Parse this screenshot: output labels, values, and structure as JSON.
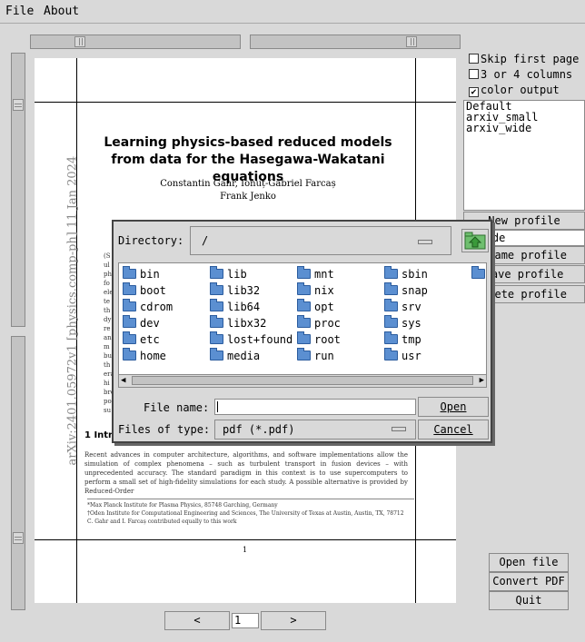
{
  "menu": {
    "file": "File",
    "about": "About"
  },
  "document": {
    "title": "Learning physics-based reduced models from data for the Hasegawa-Wakatani equations",
    "authors_line1": "Constantin Gahr, Ionuț-Gabriel Farcaș",
    "authors_line2": "Frank Jenko",
    "arxiv_stamp": "arXiv:2401.05972v1  [physics.comp-ph]  11 Jan 2024",
    "section_heading": "1  Intr",
    "intro_text": "Recent advances in computer architecture, algorithms, and software implementations allow the simulation of complex phenomena – such as turbulent transport in fusion devices – with unprecedented accuracy. The standard paradigm in this context is to use supercomputers to perform a small set of high-fidelity simulations for each study.  A possible alternative is provided by Reduced-Order",
    "footnote1": "*Max Planck Institute for Plasma Physics, 85748 Garching, Germany",
    "footnote2": "†Oden Institute for Computational Engineering and Sciences, The University of Texas at Austin, Austin, TX, 78712",
    "footnote3": "C. Gahr and I. Farcaș contributed equally to this work",
    "page_number": "1",
    "abstract_fragments": [
      "(S",
      "ul",
      "ph",
      "fo",
      "ele",
      "te",
      "th",
      "dy",
      "re",
      "an",
      "m",
      "bu",
      "th",
      "era",
      "hi",
      "bre",
      "po",
      "su"
    ]
  },
  "options": {
    "skip_first_page": {
      "label": "Skip first page",
      "checked": false
    },
    "columns": {
      "label": "3 or 4 columns",
      "checked": false
    },
    "color_output": {
      "label": "color output",
      "checked": true,
      "mark": "✔"
    }
  },
  "profiles": [
    "Default",
    "arxiv_small",
    "arxiv_wide"
  ],
  "profile_name_value": "v_wide",
  "profile_buttons": {
    "new": "New profile",
    "rename": "ename profile",
    "save": "Save profile",
    "delete": "elete profile"
  },
  "actions": {
    "open_file": "Open file",
    "convert_pdf": "Convert PDF",
    "quit": "Quit"
  },
  "pager": {
    "prev": "<",
    "next": ">",
    "page_value": "1"
  },
  "dialog": {
    "directory_label": "Directory:",
    "directory_value": "/",
    "files": [
      [
        "bin",
        "lib",
        "mnt",
        "sbin"
      ],
      [
        "boot",
        "lib32",
        "nix",
        "snap"
      ],
      [
        "cdrom",
        "lib64",
        "opt",
        "srv"
      ],
      [
        "dev",
        "libx32",
        "proc",
        "sys"
      ],
      [
        "etc",
        "lost+found",
        "root",
        "tmp"
      ],
      [
        "home",
        "media",
        "run",
        "usr"
      ]
    ],
    "file_name_label": "File name:",
    "file_name_value": "",
    "files_of_type_label": "Files of type:",
    "files_of_type_value": "pdf (*.pdf)",
    "open_label": "Open",
    "cancel_label": "Cancel",
    "colors": {
      "folder": "#5b8fd1",
      "up_button": "#3a9a3a"
    }
  }
}
